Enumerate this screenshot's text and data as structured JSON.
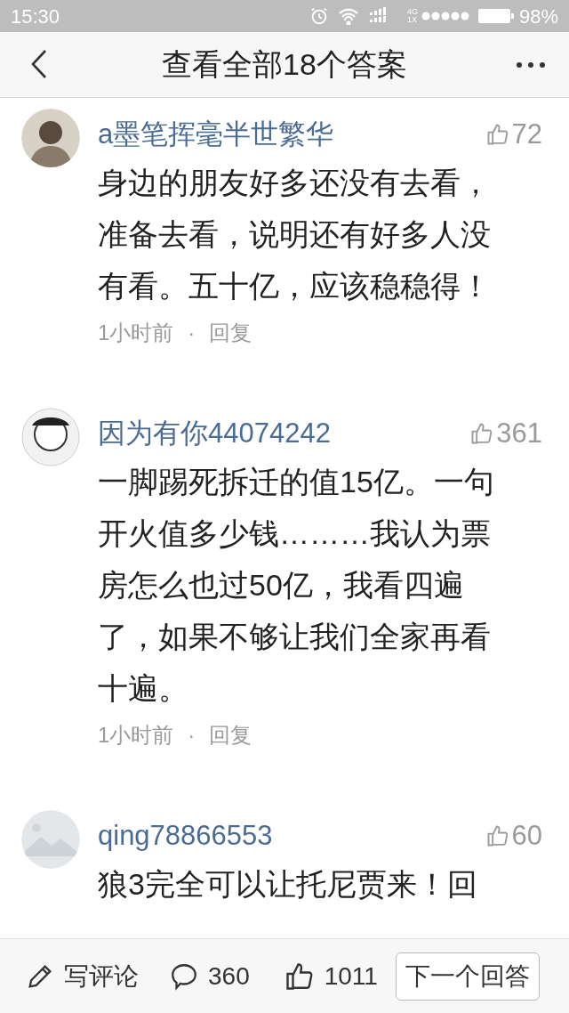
{
  "status_bar": {
    "time": "15:30",
    "network_top": "4G",
    "network_bottom": "1X",
    "battery": "98%"
  },
  "header": {
    "title": "查看全部18个答案"
  },
  "comments": [
    {
      "kind": "person",
      "name": "a墨笔挥毫半世繁华",
      "likes": "72",
      "text": "身边的朋友好多还没有去看，准备去看，说明还有好多人没有看。五十亿，应该稳稳得！",
      "time": "1小时前",
      "separator": "·",
      "reply": "回复"
    },
    {
      "kind": "cartoon",
      "name": "因为有你44074242",
      "likes": "361",
      "text": "一脚踢死拆迁的值15亿。一句开火值多少钱………我认为票房怎么也过50亿，我看四遍了，如果不够让我们全家再看十遍。",
      "time": "1小时前",
      "separator": "·",
      "reply": "回复"
    },
    {
      "kind": "landscape",
      "name": "qing78866553",
      "likes": "60",
      "text": "狼3完全可以让托尼贾来！回"
    }
  ],
  "bottom_bar": {
    "write": "写评论",
    "comments": "360",
    "likes": "1011",
    "next": "下一个回答"
  }
}
